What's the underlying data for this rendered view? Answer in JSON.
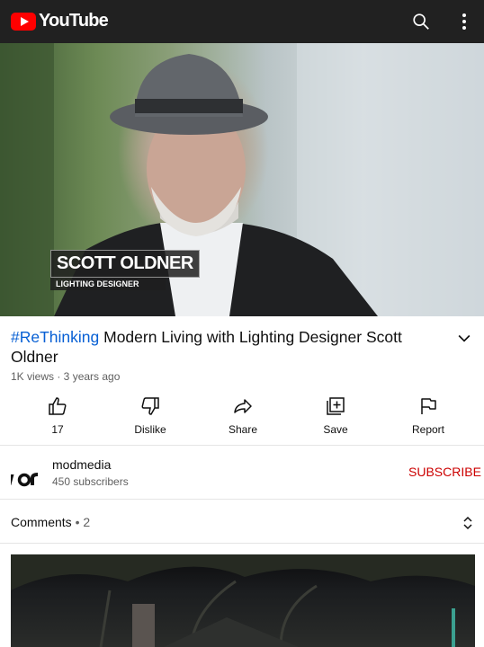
{
  "app": {
    "brand": "YouTube",
    "brand_color": "#ff0000",
    "header_bg": "#212121",
    "link_color": "#065fd4",
    "subscribe_color": "#cc0000"
  },
  "header": {
    "search_icon": "search-icon",
    "menu_icon": "more-vert-icon"
  },
  "video": {
    "lower_third_name": "SCOTT OLDNER",
    "lower_third_role": "LIGHTING DESIGNER"
  },
  "details": {
    "hashtag": "#ReThinking",
    "title": " Modern Living with Lighting Designer Scott Oldner",
    "meta": "1K views · 3 years ago"
  },
  "actions": [
    {
      "icon": "thumb-up-icon",
      "label": "17"
    },
    {
      "icon": "thumb-down-icon",
      "label": "Dislike"
    },
    {
      "icon": "share-icon",
      "label": "Share"
    },
    {
      "icon": "save-icon",
      "label": "Save"
    },
    {
      "icon": "flag-icon",
      "label": "Report"
    }
  ],
  "channel": {
    "name": "modmedia",
    "subscribers": "450 subscribers",
    "subscribe_label": "SUBSCRIBE"
  },
  "comments": {
    "label": "Comments",
    "separator": " • ",
    "count": "2"
  }
}
